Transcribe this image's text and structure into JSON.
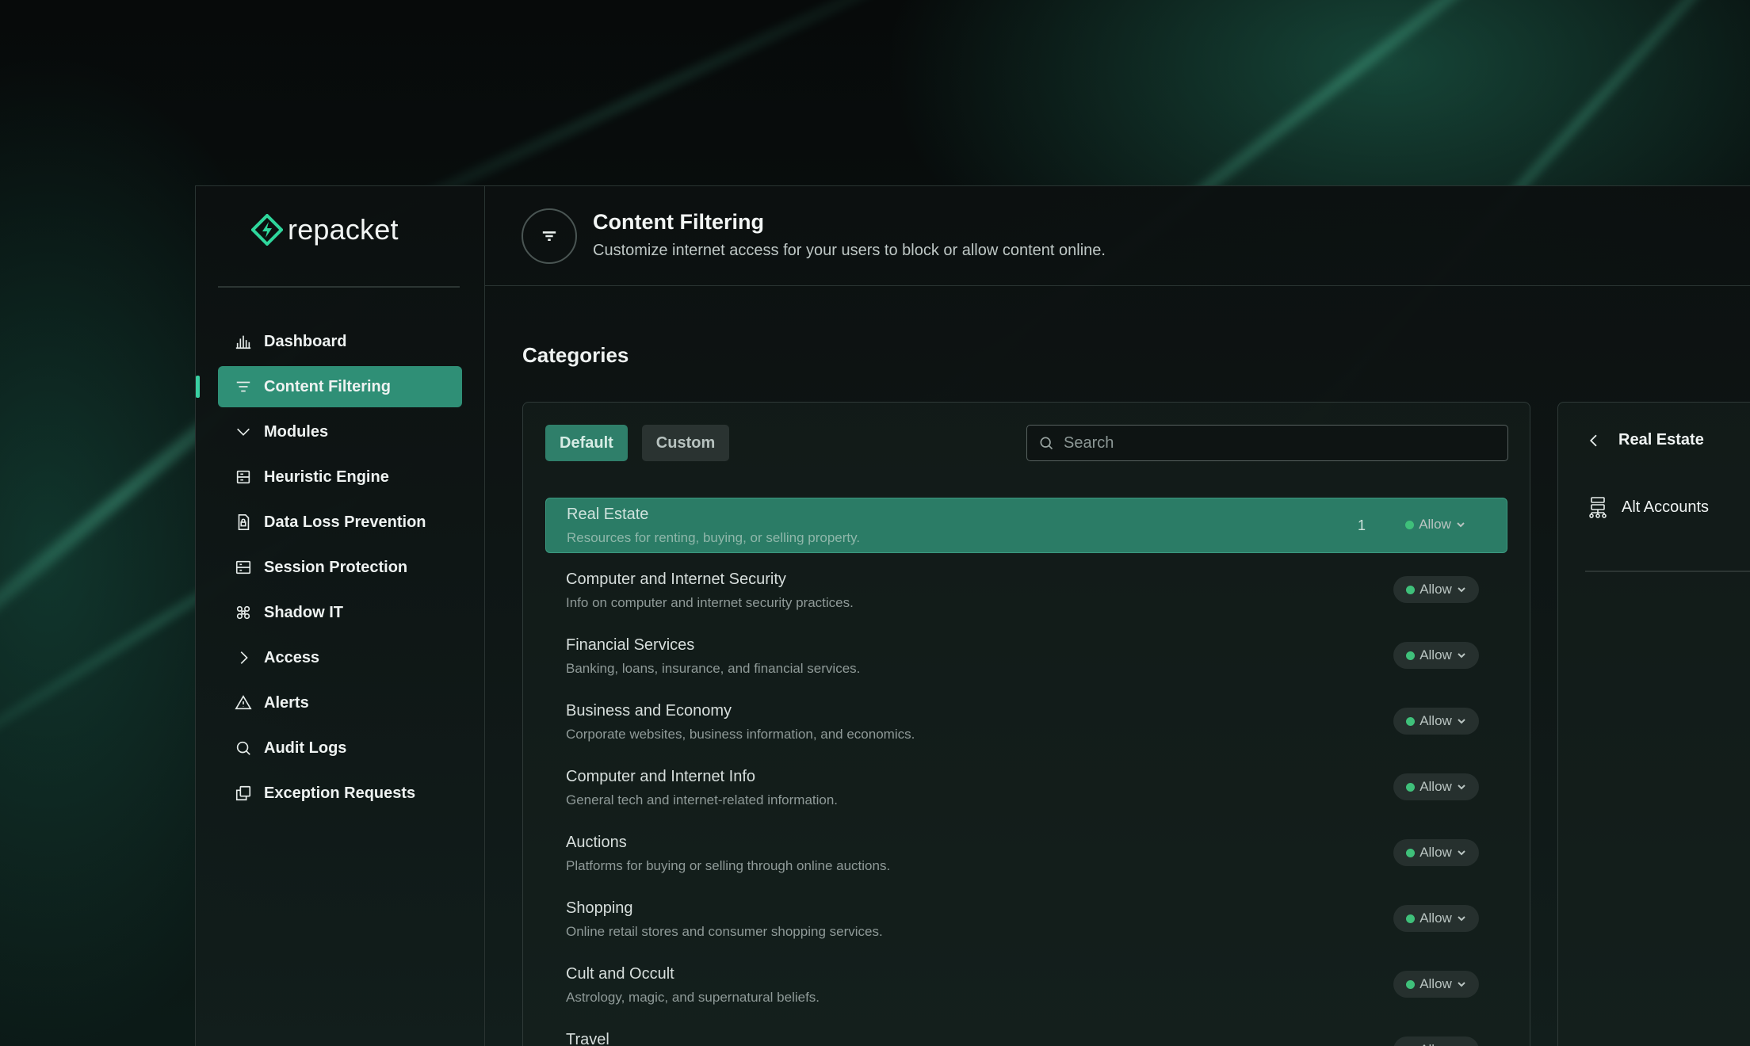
{
  "brand": {
    "name": "repacket"
  },
  "sidebar": {
    "items": [
      {
        "label": "Dashboard",
        "icon": "bar-chart-icon"
      },
      {
        "label": "Content Filtering",
        "icon": "filter-icon",
        "active": true
      },
      {
        "label": "Modules",
        "icon": "chevron-down-icon"
      },
      {
        "label": "Heuristic Engine",
        "icon": "heuristic-engine-icon"
      },
      {
        "label": "Data Loss Prevention",
        "icon": "document-lock-icon"
      },
      {
        "label": "Session Protection",
        "icon": "session-icon"
      },
      {
        "label": "Shadow IT",
        "icon": "command-icon"
      },
      {
        "label": "Access",
        "icon": "chevron-right-icon"
      },
      {
        "label": "Alerts",
        "icon": "warning-triangle-icon"
      },
      {
        "label": "Audit Logs",
        "icon": "search-icon"
      },
      {
        "label": "Exception Requests",
        "icon": "copy-icon"
      }
    ]
  },
  "header": {
    "title": "Content Filtering",
    "subtitle": "Customize internet access for your users to block or allow content online."
  },
  "categories": {
    "section_title": "Categories",
    "tabs": [
      {
        "label": "Default",
        "selected": true
      },
      {
        "label": "Custom",
        "selected": false
      }
    ],
    "search": {
      "placeholder": "Search",
      "value": ""
    },
    "rows": [
      {
        "name": "Real Estate",
        "description": "Resources for renting, buying, or selling property.",
        "count": "1",
        "action": "Allow",
        "selected": true
      },
      {
        "name": "Computer and Internet Security",
        "description": "Info on computer and internet security practices.",
        "count": "",
        "action": "Allow",
        "selected": false
      },
      {
        "name": "Financial Services",
        "description": "Banking, loans, insurance, and financial services.",
        "count": "",
        "action": "Allow",
        "selected": false
      },
      {
        "name": "Business and Economy",
        "description": "Corporate websites, business information, and economics.",
        "count": "",
        "action": "Allow",
        "selected": false
      },
      {
        "name": "Computer and Internet Info",
        "description": "General tech and internet-related information.",
        "count": "",
        "action": "Allow",
        "selected": false
      },
      {
        "name": "Auctions",
        "description": "Platforms for buying or selling through online auctions.",
        "count": "",
        "action": "Allow",
        "selected": false
      },
      {
        "name": "Shopping",
        "description": "Online retail stores and consumer shopping services.",
        "count": "",
        "action": "Allow",
        "selected": false
      },
      {
        "name": "Cult and Occult",
        "description": "Astrology, magic, and supernatural beliefs.",
        "count": "",
        "action": "Allow",
        "selected": false
      },
      {
        "name": "Travel",
        "description": "",
        "count": "",
        "action": "Allow",
        "selected": false
      }
    ]
  },
  "detail": {
    "title": "Real Estate",
    "items": [
      {
        "label": "Alt Accounts",
        "icon": "sitemap-icon"
      }
    ]
  },
  "colors": {
    "accent": "#2f8f76",
    "active_indicator": "#39d0a2",
    "allow_dot": "#3fc07a"
  }
}
